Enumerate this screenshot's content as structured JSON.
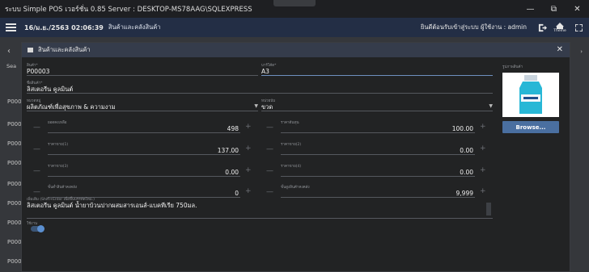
{
  "window": {
    "title": "ระบบ Simple POS เวอร์ชั่น 0.85 Server : DESKTOP-MS78AAG\\SQLEXPRESS",
    "minimize": "—",
    "restore": "⧉",
    "close": "✕"
  },
  "appbar": {
    "datetime": "16/ม.ย./2563 02:06:39",
    "breadcrumb": "สินค้าและคลังสินค้า",
    "welcome": "ยินดีต้อนรับเข้าสู่ระบบ ผู้ใช้งาน : admin",
    "theme_label": "Theme"
  },
  "background": {
    "search_label": "Sea",
    "rows": [
      "P000",
      "P000",
      "P000",
      "P000",
      "P000",
      "P000",
      "P000",
      "P000",
      "P000"
    ]
  },
  "dialog": {
    "title": "สินค้าและคลังสินค้า",
    "fields": {
      "product_id": {
        "label": "สินค้า*",
        "value": "P00003"
      },
      "barcode": {
        "label": "บาร์โค้ด*",
        "value": "A3"
      },
      "product_name": {
        "label": "ชื่อสินค้า*",
        "value": "ลิสเตอรีน คูลมินต์"
      },
      "category": {
        "label": "หมวดหมู่",
        "value": "ผลิตภัณฑ์เพื่อสุขภาพ & ความงาม"
      },
      "unit": {
        "label": "หน่วยนับ",
        "value": "ขวด"
      },
      "stock": {
        "label": "ยอดคงเหลือ",
        "value": "498"
      },
      "cost": {
        "label": "ราคาต้นทุน",
        "value": "100.00"
      },
      "price1": {
        "label": "ราคาขาย(1)",
        "value": "137.00"
      },
      "price2": {
        "label": "ราคาขาย(2)",
        "value": "0.00"
      },
      "price3": {
        "label": "ราคาขาย(3)",
        "value": "0.00"
      },
      "price4": {
        "label": "ราคาขาย(4)",
        "value": "0.00"
      },
      "min_stock": {
        "label": "ขั้นต่ำสินค้าคงคลัง",
        "value": "0"
      },
      "max_stock": {
        "label": "ขั้นสูงสินค้าคงคลัง",
        "value": "9,999"
      },
      "description": {
        "label": "เพิ่มเติม (Shift+Enter เพื่อขึ้นบรรทัดใหม่.)",
        "value": "ลิสเตอรีน คูลมินต์ น้ำยาบ้วนปากผสมสารเอนส์-แบคทีเรีย 750มล."
      },
      "active": {
        "label": "ใช้งาน",
        "value": true
      }
    },
    "image_label": "รูปภาพสินค้า",
    "browse_label": "Browse..."
  }
}
